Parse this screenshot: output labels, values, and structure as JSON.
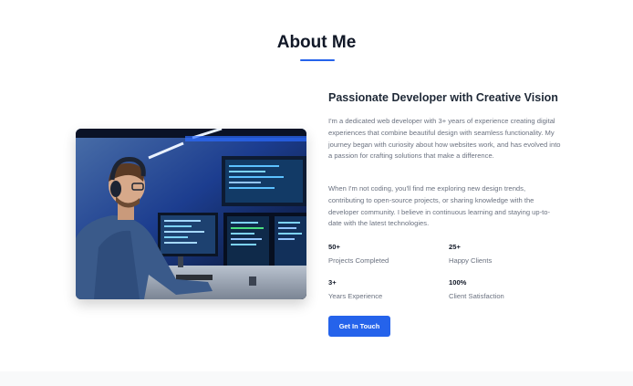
{
  "section": {
    "title": "About Me"
  },
  "about": {
    "heading": "Passionate Developer with Creative Vision",
    "paragraphs": [
      "I'm a dedicated web developer with 3+ years of experience creating digital experiences that combine beautiful design with seamless functionality. My journey began with curiosity about how websites work, and has evolved into a passion for crafting solutions that make a difference.",
      "When I'm not coding, you'll find me exploring new design trends, contributing to open-source projects, or sharing knowledge with the developer community. I believe in continuous learning and staying up-to-date with the latest technologies."
    ],
    "stats": [
      {
        "value": "50+",
        "label": "Projects Completed"
      },
      {
        "value": "25+",
        "label": "Happy Clients"
      },
      {
        "value": "3+",
        "label": "Years Experience"
      },
      {
        "value": "100%",
        "label": "Client Satisfaction"
      }
    ],
    "cta_label": "Get In Touch"
  },
  "colors": {
    "accent": "#2563eb",
    "heading": "#111827",
    "body_text": "#6b7280"
  }
}
